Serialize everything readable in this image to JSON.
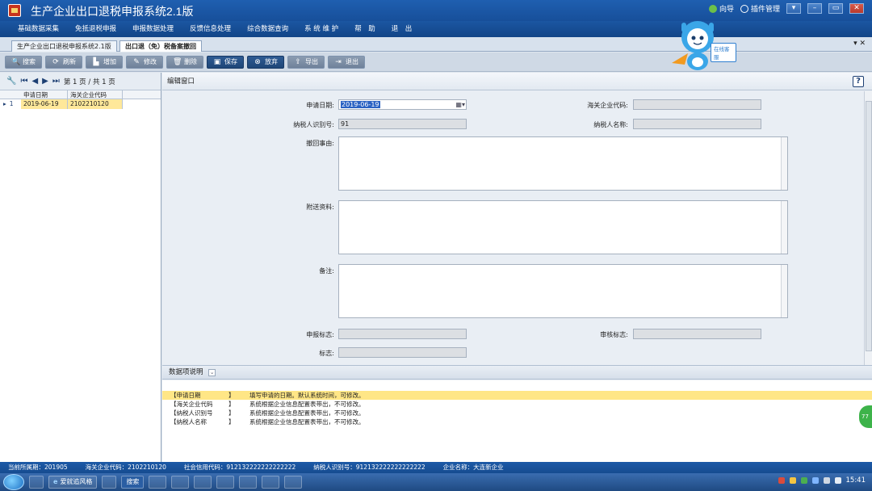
{
  "window": {
    "title": "生产企业出口退税申报系统2.1版",
    "links": [
      {
        "label": "向导",
        "icon": "guide-icon"
      },
      {
        "label": "插件管理",
        "icon": "gear-icon"
      }
    ]
  },
  "menu": [
    "基础数据采集",
    "免抵退税申报",
    "申报数据处理",
    "反馈信息处理",
    "综合数据查询",
    "系 统 维 护",
    "帮　助",
    "退　出"
  ],
  "mascot": {
    "badge": "在线客服"
  },
  "tabs": [
    "生产企业出口退税申报系统2.1版",
    "出口退（免）税备案撤回"
  ],
  "toolbar": [
    {
      "label": "搜索",
      "icon": "search-icon",
      "glyph": "🔍"
    },
    {
      "label": "刷新",
      "icon": "refresh-icon",
      "glyph": "⟳"
    },
    {
      "label": "增加",
      "icon": "add-icon",
      "glyph": "▙"
    },
    {
      "label": "修改",
      "icon": "edit-icon",
      "glyph": "✎"
    },
    {
      "label": "删除",
      "icon": "delete-icon",
      "glyph": "🗑"
    },
    {
      "label": "保存",
      "icon": "save-icon",
      "glyph": "▣"
    },
    {
      "label": "放弃",
      "icon": "cancel-icon",
      "glyph": "⊗"
    },
    {
      "label": "导出",
      "icon": "export-icon",
      "glyph": "⇪"
    },
    {
      "label": "退出",
      "icon": "exit-icon",
      "glyph": "⇥"
    }
  ],
  "pager": {
    "text": "第 1 页 / 共 1 页"
  },
  "grid": {
    "columns": [
      "申请日期",
      "海关企业代码"
    ],
    "rows": [
      {
        "num": "1",
        "date": "2019-06-19",
        "code": "2102210120"
      }
    ]
  },
  "edit": {
    "header": "编辑窗口",
    "help": "?",
    "fields": {
      "apply_date_label": "申请日期:",
      "apply_date_value": "2019-06-19",
      "customs_code_label": "海关企业代码:",
      "taxpayer_id_label": "纳税人识别号:",
      "taxpayer_id_value": "91",
      "taxpayer_name_label": "纳税人名称:",
      "reason_label": "撤回事由:",
      "attachment_label": "附送资料:",
      "remark_label": "备注:",
      "declare_flag_label": "申报标志:",
      "review_flag_label": "审核标志:",
      "flag_label": "标志:"
    }
  },
  "notes": {
    "header": "数据项说明",
    "rows": [
      {
        "key": "【申请日期",
        "sep": "】",
        "text": "填写申请的日期。默认系统时间，可修改。"
      },
      {
        "key": "【海关企业代码",
        "sep": "】",
        "text": "系统根据企业信息配置表带出，不可修改。"
      },
      {
        "key": "【纳税人识别号",
        "sep": "】",
        "text": "系统根据企业信息配置表带出，不可修改。"
      },
      {
        "key": "【纳税人名称",
        "sep": "】",
        "text": "系统根据企业信息配置表带出，不可修改。"
      }
    ]
  },
  "status": [
    "当前所属期：201905",
    "海关企业代码：2102210120",
    "社会信用代码：912132222222222222",
    "纳税人识别号：912132222222222222",
    "企业名称：大连新企业"
  ],
  "taskbar": {
    "items": [
      "爱就追风格",
      "搜索"
    ],
    "clock": "15:41"
  },
  "side_badge": "77"
}
